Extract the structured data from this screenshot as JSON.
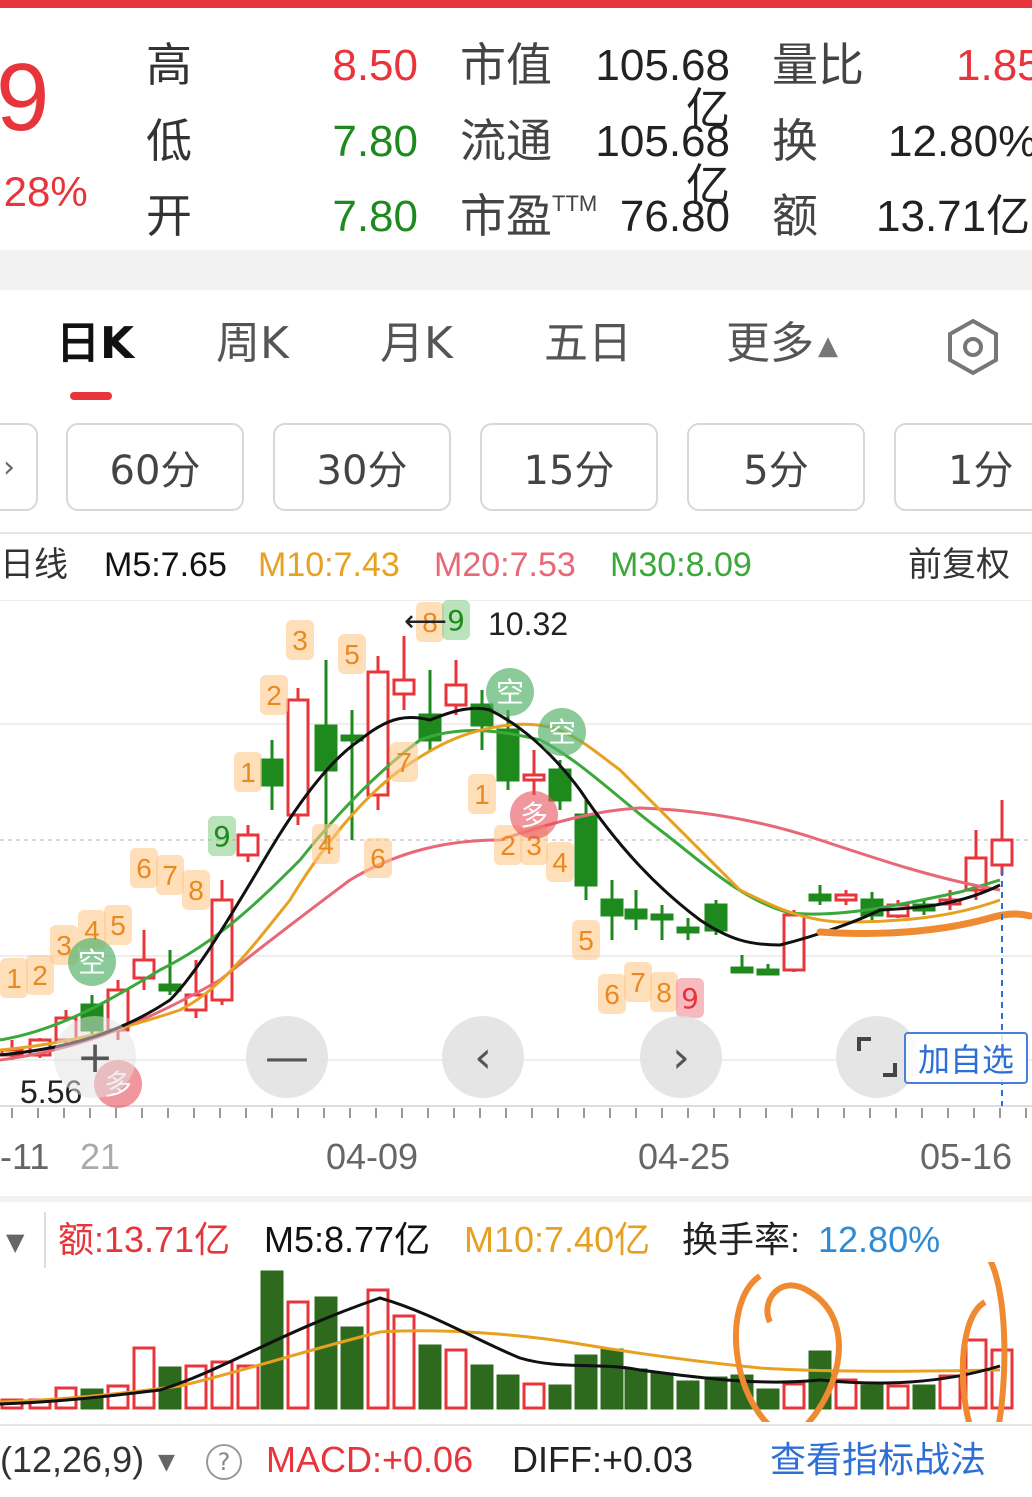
{
  "quote": {
    "price_fragment": "9",
    "change_pct": ".28%",
    "rows": [
      {
        "l1": "高",
        "v1": "8.50",
        "l2": "市值",
        "v2": "105.68亿",
        "l3": "量比",
        "v3": "1.85"
      },
      {
        "l1": "低",
        "v1": "7.80",
        "l2": "流通",
        "v2": "105.68亿",
        "l3": "换",
        "v3": "12.80%"
      },
      {
        "l1": "开",
        "v1": "7.80",
        "l2": "市盈",
        "l2sup": "TTM",
        "v2": "76.80",
        "l3": "额",
        "v3": "13.71亿"
      }
    ],
    "colors": {
      "up": "#e8343b",
      "down": "#1e8a1e"
    }
  },
  "tabs": [
    {
      "label": "日K",
      "active": true
    },
    {
      "label": "周K"
    },
    {
      "label": "月K"
    },
    {
      "label": "五日"
    },
    {
      "label": "更多"
    }
  ],
  "intervals": [
    "60分",
    "30分",
    "15分",
    "5分",
    "1分"
  ],
  "ma": {
    "line": "日线",
    "m5": "M5:7.65",
    "m10": "M10:7.43",
    "m20": "M20:7.53",
    "m30": "M30:8.09",
    "adjust": "前复权"
  },
  "chart": {
    "high_label": "10.32",
    "low_label": "5.56",
    "x_ticks": [
      "-11",
      "21",
      "04-09",
      "04-25",
      "05-16"
    ],
    "add_watch": "加自选",
    "signal_kong": "空",
    "signal_duo": "多"
  },
  "volume": {
    "amount": "额:13.71亿",
    "m5": "M5:8.77亿",
    "m10": "M10:7.40亿",
    "turnover_label": "换手率:",
    "turnover_value": "12.80%"
  },
  "macd": {
    "params": "(12,26,9)",
    "value": "MACD:+0.06",
    "diff": "DIFF:+0.03",
    "link": "查看指标战法"
  },
  "chart_data": {
    "type": "candlestick",
    "price_max_label": 10.32,
    "price_min_label": 5.56,
    "dates_shown": [
      "04-09",
      "04-25",
      "05-16"
    ],
    "moving_averages": {
      "M5": 7.65,
      "M10": 7.43,
      "M20": 7.53,
      "M30": 8.09
    },
    "volume_last": "13.71亿",
    "volume_m5": "8.77亿",
    "volume_m10": "7.40亿"
  }
}
